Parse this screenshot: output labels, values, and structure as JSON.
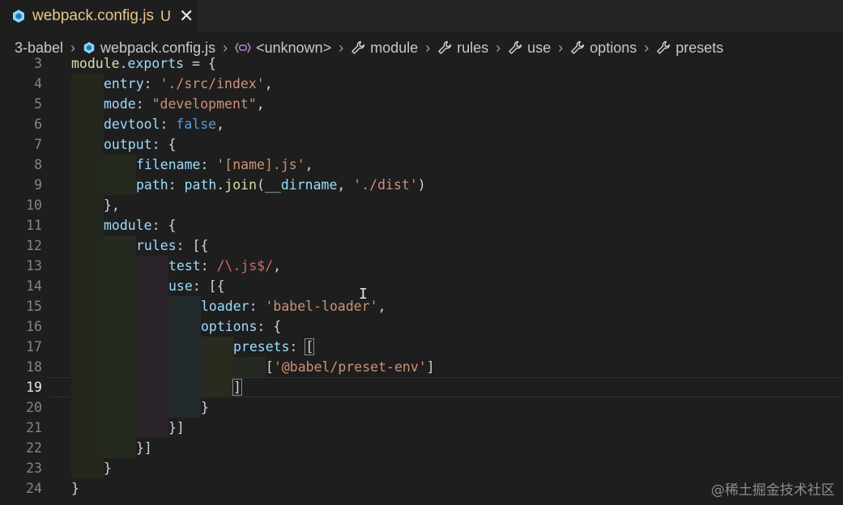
{
  "tab": {
    "filename": "webpack.config.js",
    "status": "U",
    "close_glyph": "✕"
  },
  "breadcrumb": [
    {
      "label": "3-babel",
      "icon": ""
    },
    {
      "label": "webpack.config.js",
      "icon": "webpack-icon"
    },
    {
      "label": "<unknown>",
      "icon": "symbol-variable-icon"
    },
    {
      "label": "module",
      "icon": "wrench-icon"
    },
    {
      "label": "rules",
      "icon": "wrench-icon"
    },
    {
      "label": "use",
      "icon": "wrench-icon"
    },
    {
      "label": "options",
      "icon": "wrench-icon"
    },
    {
      "label": "presets",
      "icon": "wrench-icon"
    }
  ],
  "editor": {
    "active_line": 19,
    "lines": [
      {
        "n": "3",
        "indent": 0,
        "code": [
          [
            "fn",
            "module"
          ],
          [
            "punc",
            "."
          ],
          [
            "prop",
            "exports"
          ],
          [
            "punc",
            " = {"
          ]
        ]
      },
      {
        "n": "4",
        "indent": 1,
        "code": [
          [
            "prop",
            "entry"
          ],
          [
            "punc",
            ": "
          ],
          [
            "str",
            "'./src/index'"
          ],
          [
            "punc",
            ","
          ]
        ]
      },
      {
        "n": "5",
        "indent": 1,
        "code": [
          [
            "prop",
            "mode"
          ],
          [
            "punc",
            ": "
          ],
          [
            "str",
            "\"development\""
          ],
          [
            "punc",
            ","
          ]
        ]
      },
      {
        "n": "6",
        "indent": 1,
        "code": [
          [
            "prop",
            "devtool"
          ],
          [
            "punc",
            ": "
          ],
          [
            "kw",
            "false"
          ],
          [
            "punc",
            ","
          ]
        ]
      },
      {
        "n": "7",
        "indent": 1,
        "code": [
          [
            "prop",
            "output"
          ],
          [
            "punc",
            ": {"
          ]
        ]
      },
      {
        "n": "8",
        "indent": 2,
        "code": [
          [
            "prop",
            "filename"
          ],
          [
            "punc",
            ": "
          ],
          [
            "str",
            "'[name].js'"
          ],
          [
            "punc",
            ","
          ]
        ]
      },
      {
        "n": "9",
        "indent": 2,
        "code": [
          [
            "prop",
            "path"
          ],
          [
            "punc",
            ": "
          ],
          [
            "var",
            "path"
          ],
          [
            "punc",
            "."
          ],
          [
            "fn",
            "join"
          ],
          [
            "punc",
            "("
          ],
          [
            "var",
            "__dirname"
          ],
          [
            "punc",
            ", "
          ],
          [
            "str",
            "'./dist'"
          ],
          [
            "punc",
            ")"
          ]
        ]
      },
      {
        "n": "10",
        "indent": 1,
        "code": [
          [
            "punc",
            "},"
          ]
        ]
      },
      {
        "n": "11",
        "indent": 1,
        "code": [
          [
            "prop",
            "module"
          ],
          [
            "punc",
            ": {"
          ]
        ]
      },
      {
        "n": "12",
        "indent": 2,
        "code": [
          [
            "prop",
            "rules"
          ],
          [
            "punc",
            ": [{"
          ]
        ]
      },
      {
        "n": "13",
        "indent": 3,
        "code": [
          [
            "prop",
            "test"
          ],
          [
            "punc",
            ": "
          ],
          [
            "regex",
            "/\\.js$/"
          ],
          [
            "punc",
            ","
          ]
        ]
      },
      {
        "n": "14",
        "indent": 3,
        "code": [
          [
            "prop",
            "use"
          ],
          [
            "punc",
            ": [{"
          ]
        ]
      },
      {
        "n": "15",
        "indent": 4,
        "code": [
          [
            "prop",
            "loader"
          ],
          [
            "punc",
            ": "
          ],
          [
            "str",
            "'babel-loader'"
          ],
          [
            "punc",
            ","
          ]
        ]
      },
      {
        "n": "16",
        "indent": 4,
        "code": [
          [
            "prop",
            "options"
          ],
          [
            "punc",
            ": {"
          ]
        ]
      },
      {
        "n": "17",
        "indent": 5,
        "code": [
          [
            "prop",
            "presets"
          ],
          [
            "punc",
            ": "
          ],
          [
            "box",
            "["
          ]
        ]
      },
      {
        "n": "18",
        "indent": 6,
        "code": [
          [
            "punc",
            "["
          ],
          [
            "str",
            "'@babel/preset-env'"
          ],
          [
            "punc",
            "]"
          ]
        ]
      },
      {
        "n": "19",
        "indent": 5,
        "code": [
          [
            "box",
            "]"
          ]
        ]
      },
      {
        "n": "20",
        "indent": 4,
        "code": [
          [
            "punc",
            "}"
          ]
        ]
      },
      {
        "n": "21",
        "indent": 3,
        "code": [
          [
            "punc",
            "}]"
          ]
        ]
      },
      {
        "n": "22",
        "indent": 2,
        "code": [
          [
            "punc",
            "}]"
          ]
        ]
      },
      {
        "n": "23",
        "indent": 1,
        "code": [
          [
            "punc",
            "}"
          ]
        ]
      },
      {
        "n": "24",
        "indent": 0,
        "code": [
          [
            "punc",
            "}"
          ]
        ]
      }
    ]
  },
  "watermark": "@稀土掘金技术社区",
  "colors": {
    "guide_1": "#23271d",
    "guide_2": "#252a1e",
    "guide_3": "#2a2329",
    "guide_4": "#222a2b",
    "guide_5": "#2a2b1f",
    "guide_6": "#242a22"
  }
}
